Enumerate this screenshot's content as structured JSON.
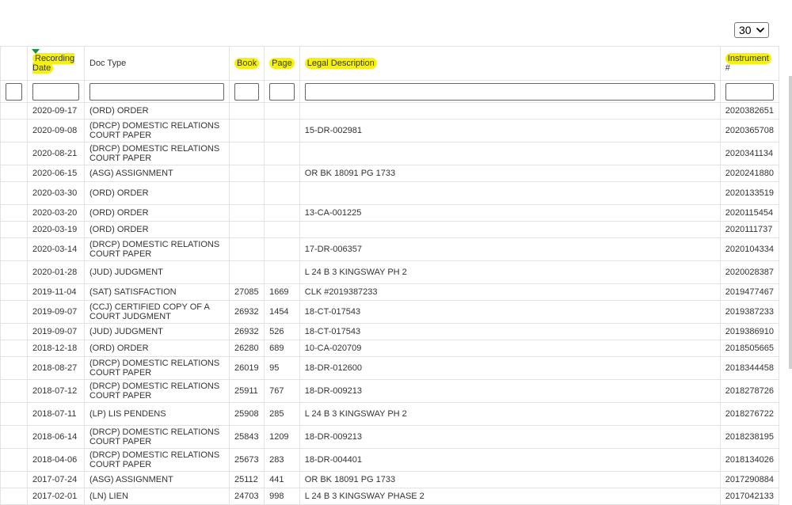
{
  "page_size": {
    "value": "30"
  },
  "columns": {
    "recording_date": "Recording Date",
    "doc_type": "Doc Type",
    "book": "Book",
    "page": "Page",
    "legal_description": "Legal Description",
    "instrument_hl": "Instrument",
    "instrument_rest": "#"
  },
  "rows": [
    {
      "date": "2020-09-17",
      "doc_type": "(ORD) ORDER",
      "book": "",
      "page": "",
      "legal": "",
      "instrument": "2020382651"
    },
    {
      "date": "2020-09-08",
      "doc_type": "(DRCP) DOMESTIC RELATIONS COURT PAPER",
      "book": "",
      "page": "",
      "legal": "15-DR-002981",
      "instrument": "2020365708"
    },
    {
      "date": "2020-08-21",
      "doc_type": "(DRCP) DOMESTIC RELATIONS COURT PAPER",
      "book": "",
      "page": "",
      "legal": "",
      "instrument": "2020341134"
    },
    {
      "date": "2020-06-15",
      "doc_type": "(ASG) ASSIGNMENT",
      "book": "",
      "page": "",
      "legal": "OR BK 18091 PG 1733",
      "instrument": "2020241880"
    },
    {
      "date": "2020-03-30",
      "doc_type": "(ORD) ORDER",
      "book": "",
      "page": "",
      "legal": "",
      "instrument": "2020133519"
    },
    {
      "date": "2020-03-20",
      "doc_type": "(ORD) ORDER",
      "book": "",
      "page": "",
      "legal": "13-CA-001225",
      "instrument": "2020115454"
    },
    {
      "date": "2020-03-19",
      "doc_type": "(ORD) ORDER",
      "book": "",
      "page": "",
      "legal": "",
      "instrument": "2020111737"
    },
    {
      "date": "2020-03-14",
      "doc_type": "(DRCP) DOMESTIC RELATIONS COURT PAPER",
      "book": "",
      "page": "",
      "legal": "17-DR-006357",
      "instrument": "2020104334"
    },
    {
      "date": "2020-01-28",
      "doc_type": "(JUD) JUDGMENT",
      "book": "",
      "page": "",
      "legal": "L 24 B 3 KINGSWAY PH 2",
      "instrument": "2020028387"
    },
    {
      "date": "2019-11-04",
      "doc_type": "(SAT) SATISFACTION",
      "book": "27085",
      "page": "1669",
      "legal": "CLK #2019387233",
      "instrument": "2019477467"
    },
    {
      "date": "2019-09-07",
      "doc_type": "(CCJ) CERTIFIED COPY OF A COURT JUDGMENT",
      "book": "26932",
      "page": "1454",
      "legal": "18-CT-017543",
      "instrument": "2019387233"
    },
    {
      "date": "2019-09-07",
      "doc_type": "(JUD) JUDGMENT",
      "book": "26932",
      "page": "526",
      "legal": "18-CT-017543",
      "instrument": "2019386910"
    },
    {
      "date": "2018-12-18",
      "doc_type": "(ORD) ORDER",
      "book": "26280",
      "page": "689",
      "legal": "10-CA-020709",
      "instrument": "2018505665"
    },
    {
      "date": "2018-08-27",
      "doc_type": "(DRCP) DOMESTIC RELATIONS COURT PAPER",
      "book": "26019",
      "page": "95",
      "legal": "18-DR-012600",
      "instrument": "2018344458"
    },
    {
      "date": "2018-07-12",
      "doc_type": "(DRCP) DOMESTIC RELATIONS COURT PAPER",
      "book": "25911",
      "page": "767",
      "legal": "18-DR-009213",
      "instrument": "2018278726"
    },
    {
      "date": "2018-07-11",
      "doc_type": "(LP) LIS PENDENS",
      "book": "25908",
      "page": "285",
      "legal": "L 24 B 3 KINGSWAY PH 2",
      "instrument": "2018276722"
    },
    {
      "date": "2018-06-14",
      "doc_type": "(DRCP) DOMESTIC RELATIONS COURT PAPER",
      "book": "25843",
      "page": "1209",
      "legal": "18-DR-009213",
      "instrument": "2018238195"
    },
    {
      "date": "2018-04-06",
      "doc_type": "(DRCP) DOMESTIC RELATIONS COURT PAPER",
      "book": "25673",
      "page": "283",
      "legal": "18-DR-004401",
      "instrument": "2018134026"
    },
    {
      "date": "2017-07-24",
      "doc_type": "(ASG) ASSIGNMENT",
      "book": "25112",
      "page": "441",
      "legal": "OR BK 18091 PG 1733",
      "instrument": "2017290884"
    },
    {
      "date": "2017-02-01",
      "doc_type": "(LN) LIEN",
      "book": "24703",
      "page": "998",
      "legal": "L 24 B 3 KINGSWAY PHASE 2",
      "instrument": "2017042133"
    }
  ],
  "colors": {
    "highlight": "#f6f10a",
    "sort_indicator": "#1a8f3a",
    "border": "#e3e3e3"
  },
  "icons": {
    "page_size_chevron": "chevron-down-icon",
    "sort_indicator": "sort-desc-icon"
  }
}
